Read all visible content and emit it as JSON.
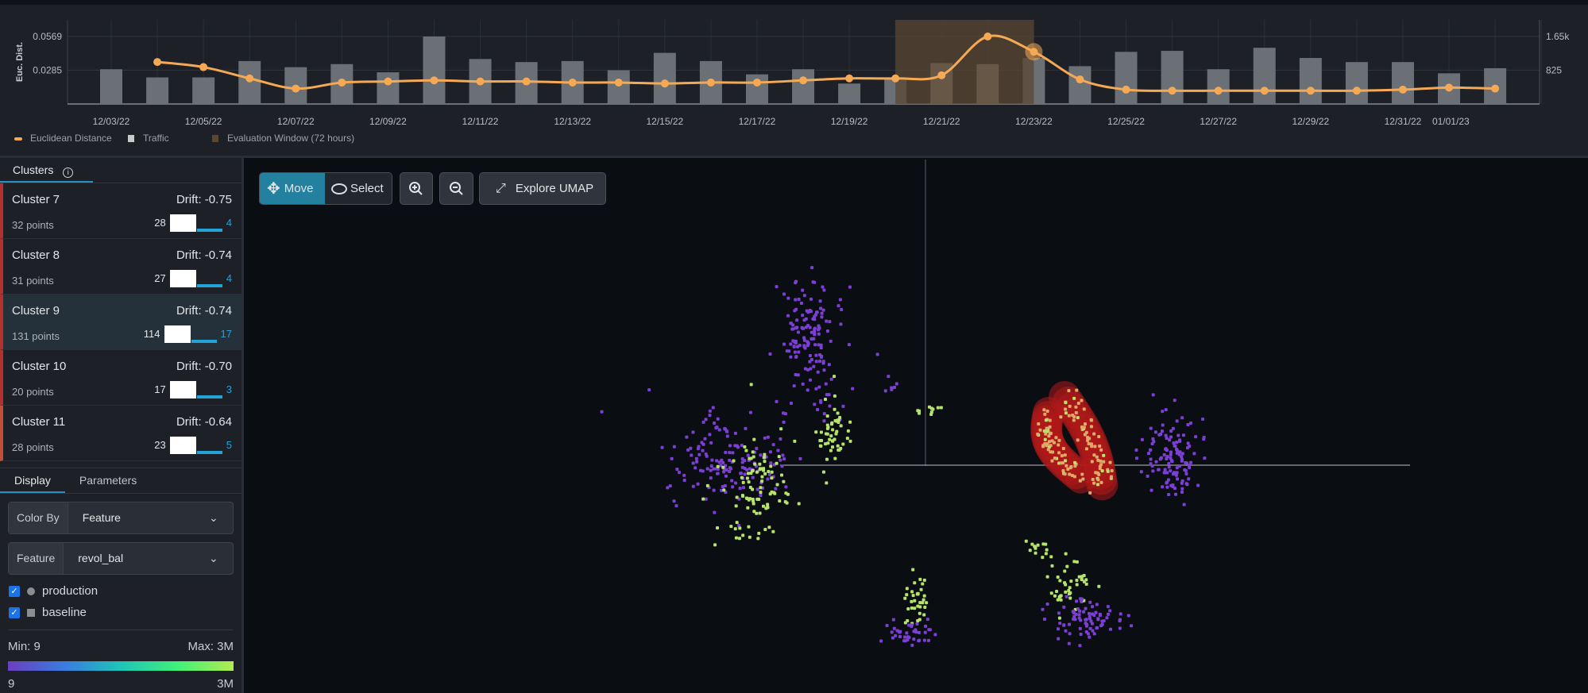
{
  "chart_data": {
    "type": "bar+line",
    "ylabel_left": "Euc. Dist.",
    "left_ticks": [
      "0.0285",
      "0.0569"
    ],
    "left_tick_values": [
      0.0285,
      0.0569
    ],
    "right_ticks": [
      "825",
      "1.65k"
    ],
    "right_tick_values": [
      825,
      1650
    ],
    "categories": [
      "12/03/22",
      "12/04/22",
      "12/05/22",
      "12/06/22",
      "12/07/22",
      "12/08/22",
      "12/09/22",
      "12/10/22",
      "12/11/22",
      "12/12/22",
      "12/13/22",
      "12/14/22",
      "12/15/22",
      "12/16/22",
      "12/17/22",
      "12/18/22",
      "12/19/22",
      "12/20/22",
      "12/21/22",
      "12/22/22",
      "12/23/22",
      "12/24/22",
      "12/25/22",
      "12/26/22",
      "12/27/22",
      "12/28/22",
      "12/29/22",
      "12/30/22",
      "12/31/22",
      "01/01/23",
      "01/02/23"
    ],
    "x_tick_labels": [
      "12/03/22",
      "12/05/22",
      "12/07/22",
      "12/09/22",
      "12/11/22",
      "12/13/22",
      "12/15/22",
      "12/17/22",
      "12/19/22",
      "12/21/22",
      "12/23/22",
      "12/25/22",
      "12/27/22",
      "12/29/22",
      "12/31/22",
      "01/01/23"
    ],
    "series": [
      {
        "name": "Traffic",
        "type": "bar",
        "axis": "right",
        "color": "#6b6f76",
        "values": [
          850,
          650,
          650,
          1050,
          900,
          975,
          775,
          1650,
          1100,
          1025,
          1050,
          825,
          1250,
          1050,
          725,
          850,
          500,
          625,
          1000,
          975,
          1125,
          925,
          1275,
          1300,
          850,
          1375,
          1125,
          1025,
          1025,
          750,
          875
        ]
      },
      {
        "name": "Euclidean Distance",
        "type": "line",
        "axis": "left",
        "color": "#f5a954",
        "values": [
          null,
          0.0354,
          0.0311,
          0.0216,
          0.013,
          0.0181,
          0.019,
          0.0199,
          0.019,
          0.019,
          0.0181,
          0.0181,
          0.0173,
          0.0181,
          0.0181,
          0.0199,
          0.0216,
          0.0216,
          0.0242,
          0.0569,
          0.044,
          0.0207,
          0.0121,
          0.0112,
          0.0112,
          0.0112,
          0.0112,
          0.0112,
          0.0121,
          0.0138,
          0.013
        ]
      }
    ],
    "highlighted_point": "12/23/22",
    "evaluation_window": {
      "name": "Evaluation Window (72 hours)",
      "start": "12/20/22",
      "end": "12/23/22",
      "color": "#5a4632"
    },
    "legend": [
      "Euclidean Distance",
      "Traffic",
      "Evaluation Window (72 hours)"
    ],
    "legend_placement": "bottom-left",
    "grid": true
  },
  "clusters_panel": {
    "tab": "Clusters",
    "info_icon": "info-icon",
    "items": [
      {
        "name": "Cluster 7",
        "drift": "Drift: -0.75",
        "points": "32 points",
        "production": "28",
        "baseline": "4"
      },
      {
        "name": "Cluster 8",
        "drift": "Drift: -0.74",
        "points": "31 points",
        "production": "27",
        "baseline": "4"
      },
      {
        "name": "Cluster 9",
        "drift": "Drift: -0.74",
        "points": "131 points",
        "production": "114",
        "baseline": "17",
        "selected": true
      },
      {
        "name": "Cluster 10",
        "drift": "Drift: -0.70",
        "points": "20 points",
        "production": "17",
        "baseline": "3"
      },
      {
        "name": "Cluster 11",
        "drift": "Drift: -0.64",
        "points": "28 points",
        "production": "23",
        "baseline": "5"
      }
    ]
  },
  "display_panel": {
    "tabs": [
      "Display",
      "Parameters"
    ],
    "color_by_label": "Color By",
    "color_by_value": "Feature",
    "feature_label": "Feature",
    "feature_value": "revol_bal",
    "production_label": "production",
    "baseline_label": "baseline",
    "min_label": "Min: 9",
    "max_label": "Max: 3M",
    "scale_min": "9",
    "scale_max": "3M",
    "gradient_colors": [
      "#6a3fbf",
      "#3a7be0",
      "#1fc4b8",
      "#3ff07a",
      "#b2ec4e"
    ]
  },
  "toolbar": {
    "move": "Move",
    "select": "Select",
    "explore": "Explore UMAP",
    "accent": "#23809f"
  },
  "scatter_colors": {
    "low": "#7b3fd4",
    "high": "#b6e36a",
    "selected_cluster": "#b01a1a"
  }
}
